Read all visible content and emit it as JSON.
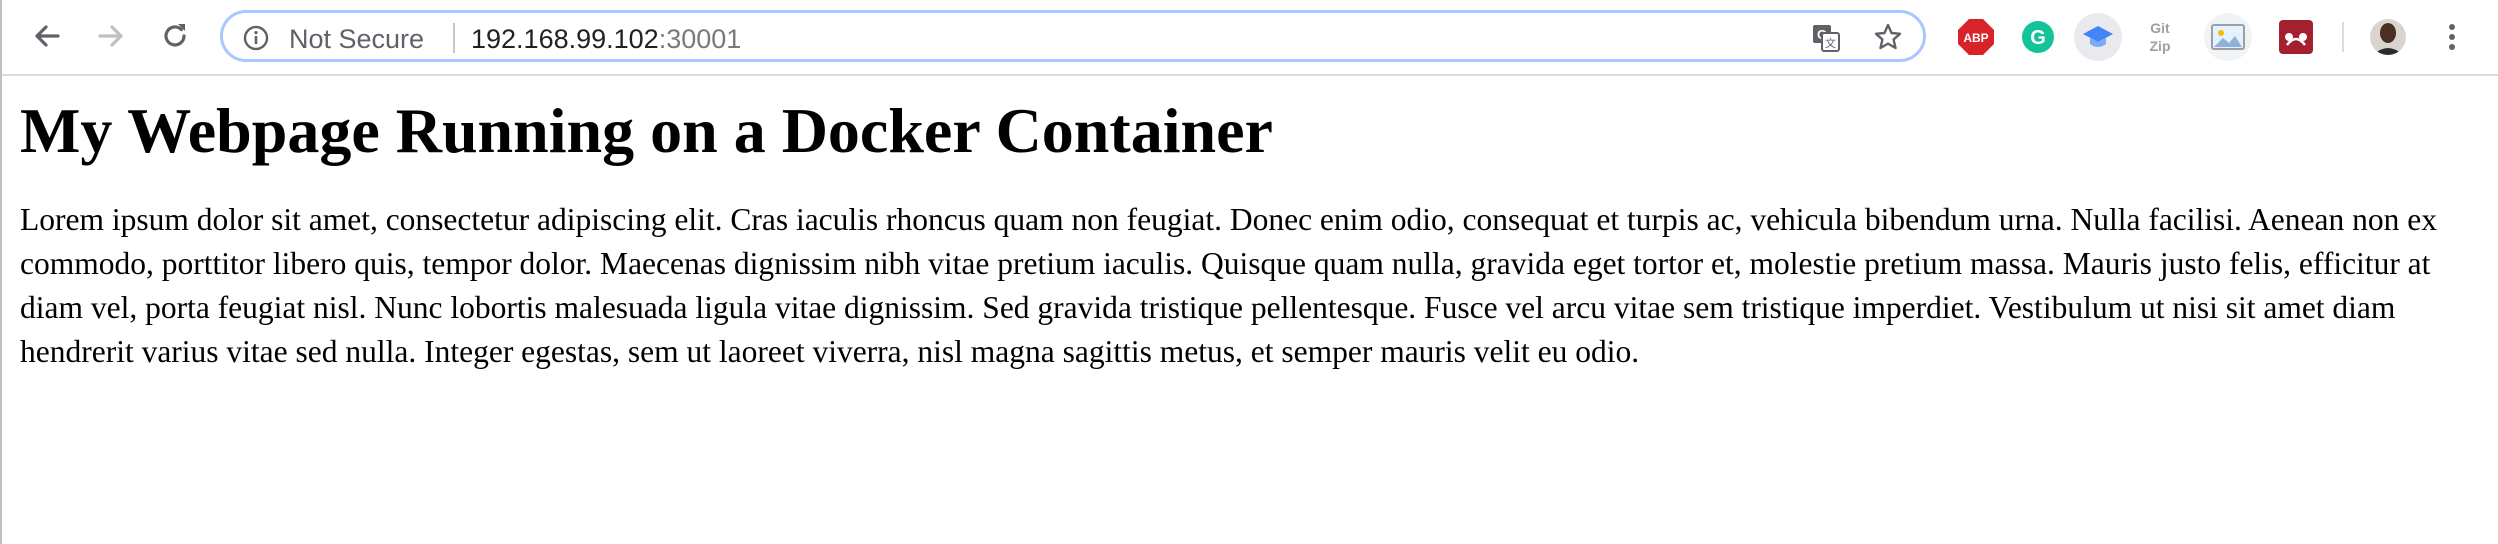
{
  "browser": {
    "back_icon": "arrow-left-icon",
    "forward_icon": "arrow-right-icon",
    "reload_icon": "reload-icon",
    "omnibox": {
      "security_icon": "info-circle-icon",
      "security_label": "Not Secure",
      "url_host": "192.168.99.102",
      "url_port": ":30001"
    },
    "translate_icon": "google-translate-icon",
    "bookmark_icon": "star-icon",
    "extensions": {
      "abp_label": "ABP",
      "abp_color": "#d8232a",
      "grammarly_label": "G",
      "grammarly_color": "#15c39a",
      "gitzip_label_top": "Git",
      "gitzip_label_bottom": "Zip",
      "scholar_color": "#4285f4",
      "mendeley_color": "#a5202e"
    },
    "menu_icon": "vertical-dots-icon"
  },
  "page": {
    "heading": "My Webpage Running on a Docker Container",
    "paragraph": "Lorem ipsum dolor sit amet, consectetur adipiscing elit. Cras iaculis rhoncus quam non feugiat. Donec enim odio, consequat et turpis ac, vehicula bibendum urna. Nulla facilisi. Aenean non ex commodo, porttitor libero quis, tempor dolor. Maecenas dignissim nibh vitae pretium iaculis. Quisque quam nulla, gravida eget tortor et, molestie pretium massa. Mauris justo felis, efficitur at diam vel, porta feugiat nisl. Nunc lobortis malesuada ligula vitae dignissim. Sed gravida tristique pellentesque. Fusce vel arcu vitae sem tristique imperdiet. Vestibulum ut nisi sit amet diam hendrerit varius vitae sed nulla. Integer egestas, sem ut laoreet viverra, nisl magna sagittis metus, et semper mauris velit eu odio."
  }
}
